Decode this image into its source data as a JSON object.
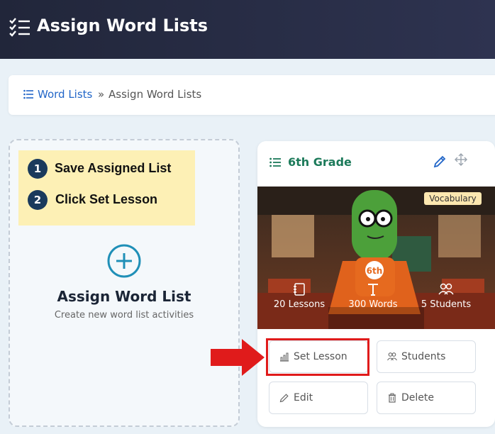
{
  "header": {
    "title": "Assign Word Lists",
    "icon": "checklist-icon"
  },
  "breadcrumb": {
    "link": "Word Lists",
    "separator": "»",
    "current": "Assign Word Lists"
  },
  "tips": [
    {
      "num": "1",
      "text": "Save Assigned List"
    },
    {
      "num": "2",
      "text": "Click Set Lesson"
    }
  ],
  "assign": {
    "title": "Assign Word List",
    "subtitle": "Create new word list activities"
  },
  "card": {
    "title": "6th Grade",
    "badge": "Vocabulary",
    "stats": [
      {
        "label": "20 Lessons",
        "icon": "notebook-icon"
      },
      {
        "label": "300 Words",
        "icon": "text-icon"
      },
      {
        "label": "5 Students",
        "icon": "users-icon"
      }
    ],
    "buttons": {
      "set_lesson": "Set Lesson",
      "students": "Students",
      "edit": "Edit",
      "delete": "Delete"
    }
  },
  "colors": {
    "accent": "#1c7a5a",
    "link": "#2266c8",
    "highlight": "#e01b1b",
    "header": "#21263a"
  }
}
